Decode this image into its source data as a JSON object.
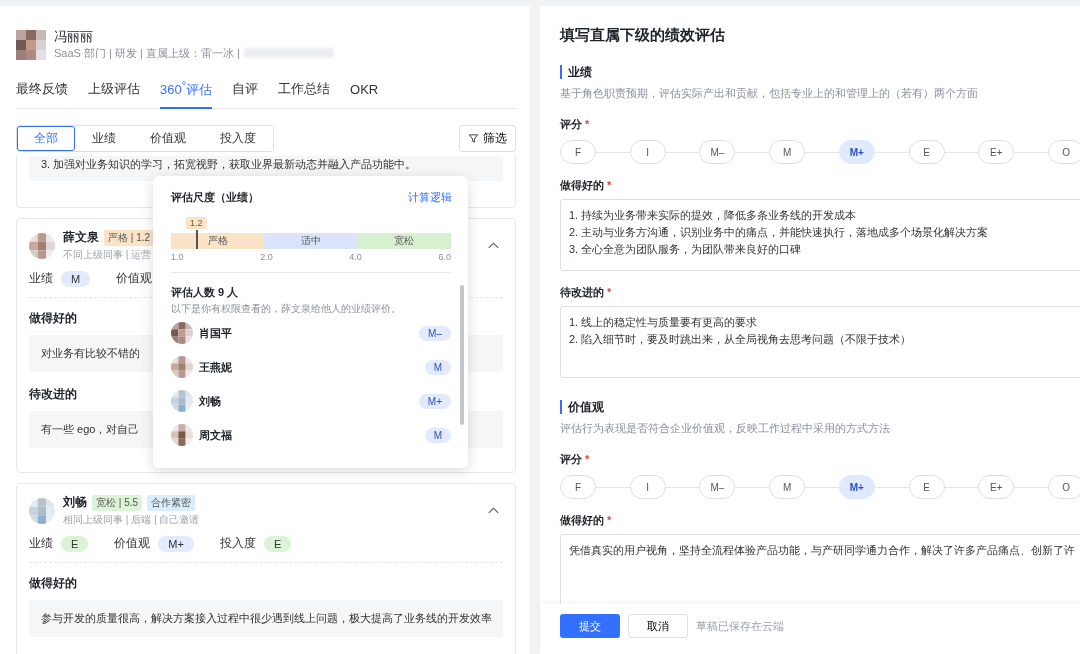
{
  "employee": {
    "name": "冯丽丽",
    "meta": "SaaS 部门 | 研发 | 直属上级：雷一冰 |"
  },
  "tabs": [
    {
      "label": "最终反馈",
      "selected": false
    },
    {
      "label": "上级评估",
      "selected": false
    },
    {
      "label": "360$^{°}$评估",
      "selected": true
    },
    {
      "label": "自评",
      "selected": false
    },
    {
      "label": "工作总结",
      "selected": false
    },
    {
      "label": "OKR",
      "selected": false
    }
  ],
  "filters": [
    {
      "label": "全部",
      "selected": true
    },
    {
      "label": "业绩",
      "selected": false
    },
    {
      "label": "价值观",
      "selected": false
    },
    {
      "label": "投入度",
      "selected": false
    }
  ],
  "filter_button": "筛选",
  "previous_card_tail": "3. 加强对业务知识的学习，拓宽视野，获取业界最新动态并融入产品功能中。",
  "reviews": [
    {
      "name": "薛文泉",
      "expanded": true,
      "tags": [
        {
          "label": "严格 | 1.2",
          "color": "#fbe3c8"
        }
      ],
      "meta": "不同上级同事 | 运营",
      "scores": [
        {
          "label": "业绩",
          "grade": "M",
          "color": "#e3eafd"
        },
        {
          "label": "价值观"
        }
      ],
      "sections": [
        {
          "title": "做得好的",
          "text": "对业务有比较不错的"
        },
        {
          "title": "待改进的",
          "text": "有一些 ego，对自己"
        }
      ]
    },
    {
      "name": "刘畅",
      "expanded": true,
      "tags": [
        {
          "label": "宽松 | 5.5",
          "color": "#dcf3d7"
        },
        {
          "label": "合作紧密",
          "color": "#d8eefb"
        }
      ],
      "meta": "相同上级同事 | 后端 | 自己邀请",
      "scores": [
        {
          "label": "业绩",
          "grade": "E",
          "color": "#dcf3d7"
        },
        {
          "label": "价值观",
          "grade": "M+",
          "color": "#e3eafd"
        },
        {
          "label": "投入度",
          "grade": "E",
          "color": "#dcf3d7"
        }
      ],
      "sections": [
        {
          "title": "做得好的",
          "text": "参与开发的质量很高，解决方案接入过程中很少遇到线上问题，极大提高了业务线的开发效率"
        }
      ]
    }
  ],
  "popover": {
    "title": "评估尺度（业绩）",
    "link": "计算逻辑",
    "marker": "1.2",
    "level": 0.09,
    "segments": [
      {
        "label": "严格",
        "color": "#fbe3c8"
      },
      {
        "label": "适中",
        "color": "#dbe4fb"
      },
      {
        "label": "宽松",
        "color": "#d7f0d0"
      }
    ],
    "ticks": [
      "1.0",
      "2.0",
      "4.0",
      "6.0"
    ],
    "count_title": "评估人数 9 人",
    "note": "以下是你有权限查看的，薛文泉给他人的业绩评价。",
    "raters": [
      {
        "name": "肖国平",
        "grade": "M–"
      },
      {
        "name": "王燕妮",
        "grade": "M"
      },
      {
        "name": "刘畅",
        "grade": "M+"
      },
      {
        "name": "周文福",
        "grade": "M"
      }
    ]
  },
  "form": {
    "title": "填写直属下级的绩效评估",
    "sections": [
      {
        "title": "业绩",
        "description": "基于角色职责预期，评估实际产出和贡献，包括专业上的和管理上的（若有）两个方面",
        "rating_label": "评分",
        "required_mark": "*",
        "grades": [
          {
            "label": "F",
            "selected": false
          },
          {
            "label": "I",
            "selected": false
          },
          {
            "label": "M–",
            "selected": false
          },
          {
            "label": "M",
            "selected": false
          },
          {
            "label": "M+",
            "selected": true
          },
          {
            "label": "E",
            "selected": false
          },
          {
            "label": "E+",
            "selected": false
          },
          {
            "label": "O",
            "selected": false
          }
        ],
        "fields": [
          {
            "label": "做得好的",
            "lines": [
              "1. 持续为业务带来实际的提效，降低多条业务线的开发成本",
              "2. 主动与业务方沟通，识别业务中的痛点，并能快速执行，落地成多个场景化解决方案",
              "3. 全心全意为团队服务，为团队带来良好的口碑"
            ]
          },
          {
            "label": "待改进的",
            "lines": [
              "1. 线上的稳定性与质量要有更高的要求",
              "2. 陷入细节时，要及时跳出来，从全局视角去思考问题（不限于技术）"
            ]
          }
        ]
      },
      {
        "title": "价值观",
        "description": "评估行为表现是否符合企业价值观，反映工作过程中采用的方式方法",
        "rating_label": "评分",
        "required_mark": "*",
        "grades": [
          {
            "label": "F",
            "selected": false
          },
          {
            "label": "I",
            "selected": false
          },
          {
            "label": "M–",
            "selected": false
          },
          {
            "label": "M",
            "selected": false
          },
          {
            "label": "M+",
            "selected": true
          },
          {
            "label": "E",
            "selected": false
          },
          {
            "label": "E+",
            "selected": false
          },
          {
            "label": "O",
            "selected": false
          }
        ],
        "fields": [
          {
            "label": "做得好的",
            "lines": [
              "凭借真实的用户视角，坚持全流程体验产品功能，与产研同学通力合作，解决了许多产品痛点、创新了许"
            ]
          }
        ]
      }
    ],
    "submit": "提交",
    "cancel": "取消",
    "draft_note": "草稿已保存在云端"
  }
}
